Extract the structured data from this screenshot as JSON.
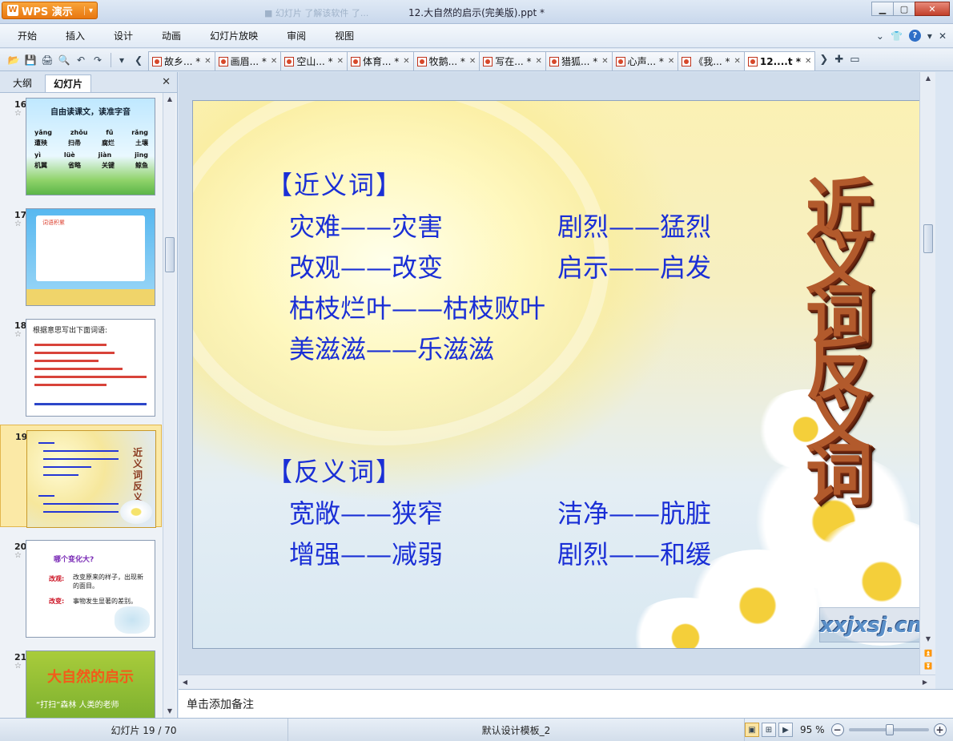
{
  "titlebar": {
    "app_button": "WPS 演示",
    "quick_access_faded": "■ 幻灯片  了解该软件  了...",
    "document_title": "12.大自然的启示(完美版).ppt *"
  },
  "menu": {
    "items": [
      "开始",
      "插入",
      "设计",
      "动画",
      "幻灯片放映",
      "审阅",
      "视图"
    ],
    "help": "?"
  },
  "tabs": [
    {
      "label": "故乡... *"
    },
    {
      "label": "画眉... *"
    },
    {
      "label": "空山... *"
    },
    {
      "label": "体育... *"
    },
    {
      "label": "牧鹅... *"
    },
    {
      "label": "写在... *"
    },
    {
      "label": "猎狐... *"
    },
    {
      "label": "心声... *"
    },
    {
      "label": "《我... *"
    },
    {
      "label": "12....t *"
    }
  ],
  "left_panel": {
    "tab_outline": "大纲",
    "tab_slides": "幻灯片",
    "thumbnails": [
      {
        "num": "16",
        "title": "自由读课文，读准字音",
        "rows": [
          [
            "yǎng",
            "zhǒu",
            "fǔ",
            "rǎng"
          ],
          [
            "遭殃",
            "扫帚",
            "腐烂",
            "土壤"
          ],
          [
            "yì",
            "lüè",
            "jiàn",
            "jīng"
          ],
          [
            "机翼",
            "省略",
            "关键",
            "鲸鱼"
          ]
        ]
      },
      {
        "num": "17",
        "title": "词语积累"
      },
      {
        "num": "18",
        "title": "根据意思写出下面词语:"
      },
      {
        "num": "19",
        "title": "近义词反义词"
      },
      {
        "num": "20",
        "title": "哪个变化大?",
        "labels": [
          "改观:",
          "改变:"
        ],
        "defs": [
          "改变原来的样子，出现新的面目。",
          "事物发生显著的差别。"
        ]
      },
      {
        "num": "21",
        "title": "大自然的启示",
        "subtitle": "“打扫”森林   人类的老师"
      }
    ]
  },
  "slide": {
    "synonym_heading": "【近义词】",
    "synonyms": [
      {
        "text": "灾难——灾害"
      },
      {
        "text": "剧烈——猛烈"
      },
      {
        "text": "改观——改变"
      },
      {
        "text": "启示——启发"
      },
      {
        "text": "枯枝烂叶——枯枝败叶"
      },
      {
        "text": "美滋滋——乐滋滋"
      }
    ],
    "antonym_heading": "【反义词】",
    "antonyms": [
      {
        "text": "宽敞——狭窄"
      },
      {
        "text": "洁净——肮脏"
      },
      {
        "text": "增强——减弱"
      },
      {
        "text": "剧烈——和缓"
      }
    ],
    "vertical_title": "近义词反义词",
    "watermark": "xxjxsj.cn"
  },
  "notes": {
    "placeholder": "单击添加备注"
  },
  "status": {
    "slide_counter": "幻灯片 19 / 70",
    "template": "默认设计模板_2",
    "zoom": "95 %",
    "zoom_level": 0.52
  }
}
